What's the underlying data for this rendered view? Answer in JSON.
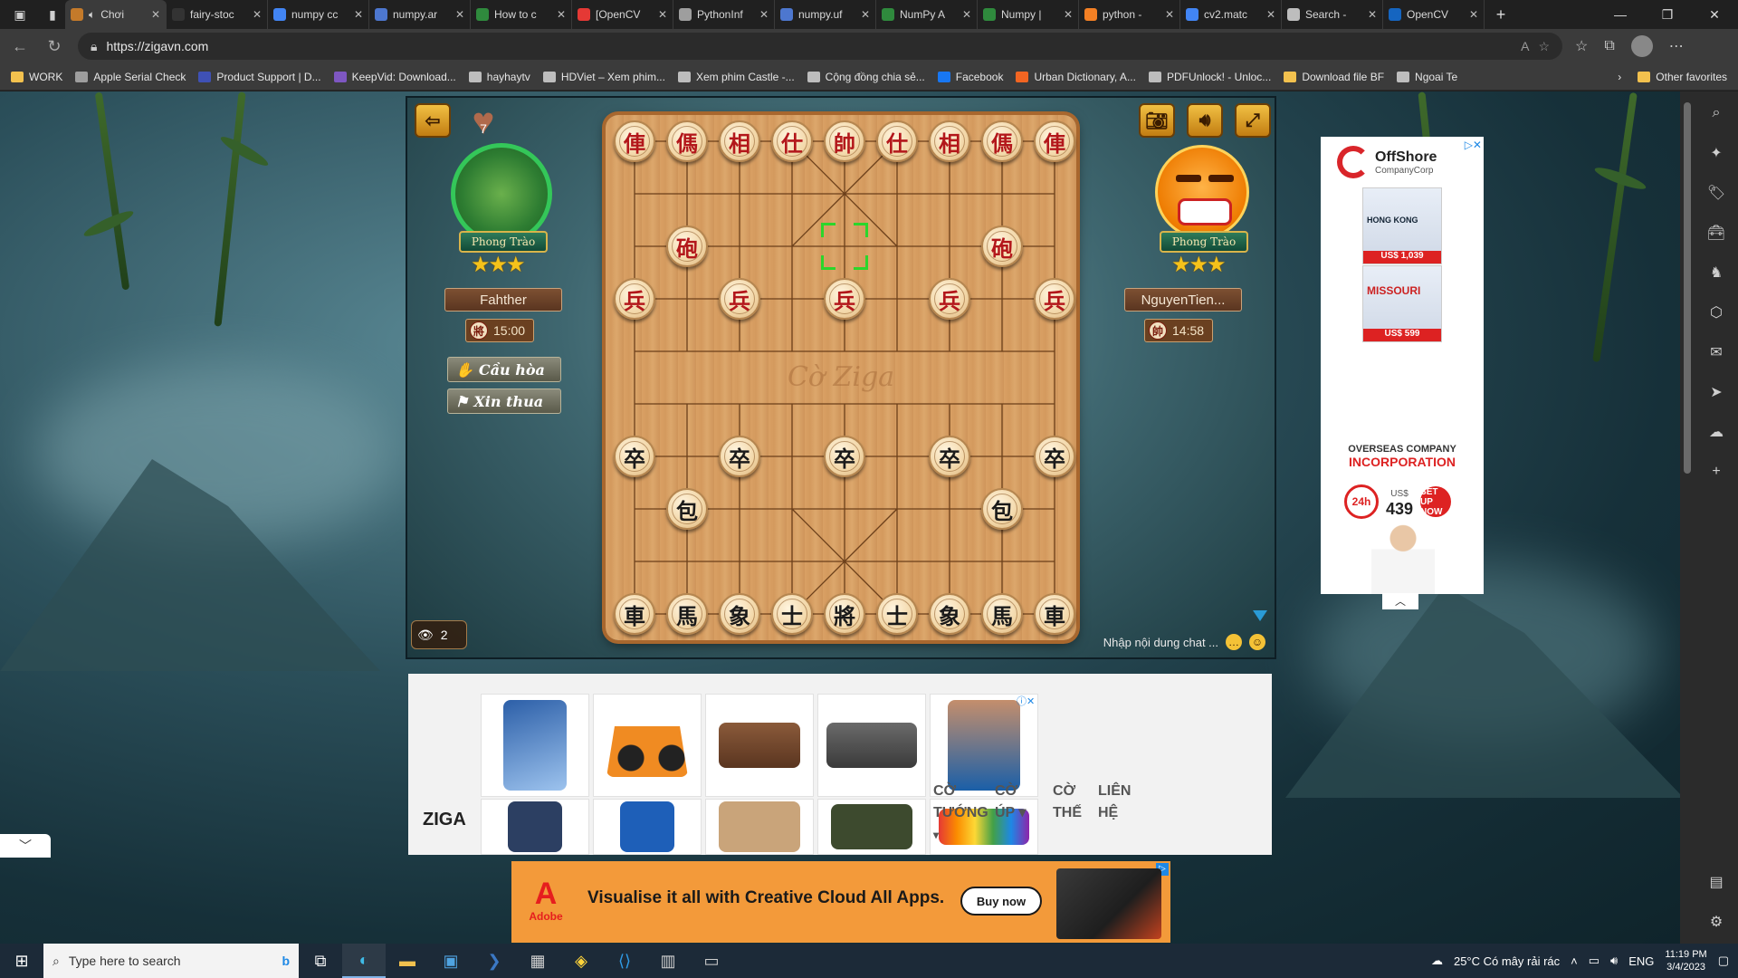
{
  "browser": {
    "tabs": [
      {
        "title": "Chơi",
        "color": "#c47a2a",
        "active": true
      },
      {
        "title": "fairy-stoc",
        "color": "#333333"
      },
      {
        "title": "numpy cc",
        "color": "#4285f4"
      },
      {
        "title": "numpy.ar",
        "color": "#4d77cf"
      },
      {
        "title": "How to c",
        "color": "#2f8a3d"
      },
      {
        "title": "[OpenCV",
        "color": "#e53935"
      },
      {
        "title": "PythonInf",
        "color": "#9e9e9e"
      },
      {
        "title": "numpy.uf",
        "color": "#4d77cf"
      },
      {
        "title": "NumPy A",
        "color": "#2f8a3d"
      },
      {
        "title": "Numpy |",
        "color": "#2f8a3d"
      },
      {
        "title": "python -",
        "color": "#f48024"
      },
      {
        "title": "cv2.matc",
        "color": "#4285f4"
      },
      {
        "title": "Search -",
        "color": "#bdbdbd"
      },
      {
        "title": "OpenCV",
        "color": "#1565c0"
      }
    ],
    "url": "https://zigavn.com",
    "bookmarks": [
      {
        "label": "WORK",
        "color": "#f2c14e"
      },
      {
        "label": "Apple Serial Check",
        "color": "#9e9e9e"
      },
      {
        "label": "Product Support | D...",
        "color": "#3f51b5"
      },
      {
        "label": "KeepVid: Download...",
        "color": "#7e57c2"
      },
      {
        "label": "hayhaytv",
        "color": "#bdbdbd"
      },
      {
        "label": "HDViet – Xem phim...",
        "color": "#bdbdbd"
      },
      {
        "label": "Xem phim Castle -...",
        "color": "#bdbdbd"
      },
      {
        "label": "Cộng đồng chia sẻ...",
        "color": "#bdbdbd"
      },
      {
        "label": "Facebook",
        "color": "#1877f2"
      },
      {
        "label": "Urban Dictionary, A...",
        "color": "#f26522"
      },
      {
        "label": "PDFUnlock! - Unloc...",
        "color": "#bdbdbd"
      },
      {
        "label": "Download file BF",
        "color": "#f2c14e"
      },
      {
        "label": "Ngoai Te",
        "color": "#bdbdbd"
      }
    ],
    "other_favorites": "Other favorites"
  },
  "game": {
    "heart_count": "7",
    "viewers": "2",
    "chat_placeholder": "Nhập nội dung chat ...",
    "river_text": "Cờ Ziga",
    "left_player": {
      "name": "Fahther",
      "rank": "Phong Trào",
      "time": "15:00",
      "timer_glyph": "將",
      "stars": "★★★"
    },
    "right_player": {
      "name": "NguyenTien...",
      "rank": "Phong Trào",
      "time": "14:58",
      "timer_glyph": "帥",
      "stars": "★★★"
    },
    "actions": {
      "draw": "Cầu hòa",
      "resign": "Xin thua"
    }
  },
  "board_pieces": [
    {
      "ch": "俥",
      "side": "red",
      "col": 0,
      "row": 0
    },
    {
      "ch": "傌",
      "side": "red",
      "col": 1,
      "row": 0
    },
    {
      "ch": "相",
      "side": "red",
      "col": 2,
      "row": 0
    },
    {
      "ch": "仕",
      "side": "red",
      "col": 3,
      "row": 0
    },
    {
      "ch": "帥",
      "side": "red",
      "col": 4,
      "row": 0
    },
    {
      "ch": "仕",
      "side": "red",
      "col": 5,
      "row": 0
    },
    {
      "ch": "相",
      "side": "red",
      "col": 6,
      "row": 0
    },
    {
      "ch": "傌",
      "side": "red",
      "col": 7,
      "row": 0
    },
    {
      "ch": "俥",
      "side": "red",
      "col": 8,
      "row": 0
    },
    {
      "ch": "砲",
      "side": "red",
      "col": 1,
      "row": 2
    },
    {
      "ch": "砲",
      "side": "red",
      "col": 7,
      "row": 2
    },
    {
      "ch": "兵",
      "side": "red",
      "col": 0,
      "row": 3
    },
    {
      "ch": "兵",
      "side": "red",
      "col": 2,
      "row": 3
    },
    {
      "ch": "兵",
      "side": "red",
      "col": 4,
      "row": 3
    },
    {
      "ch": "兵",
      "side": "red",
      "col": 6,
      "row": 3
    },
    {
      "ch": "兵",
      "side": "red",
      "col": 8,
      "row": 3
    },
    {
      "ch": "卒",
      "side": "black",
      "col": 0,
      "row": 6
    },
    {
      "ch": "卒",
      "side": "black",
      "col": 2,
      "row": 6
    },
    {
      "ch": "卒",
      "side": "black",
      "col": 4,
      "row": 6
    },
    {
      "ch": "卒",
      "side": "black",
      "col": 6,
      "row": 6
    },
    {
      "ch": "卒",
      "side": "black",
      "col": 8,
      "row": 6
    },
    {
      "ch": "包",
      "side": "black",
      "col": 1,
      "row": 7
    },
    {
      "ch": "包",
      "side": "black",
      "col": 7,
      "row": 7
    },
    {
      "ch": "車",
      "side": "black",
      "col": 0,
      "row": 9
    },
    {
      "ch": "馬",
      "side": "black",
      "col": 1,
      "row": 9
    },
    {
      "ch": "象",
      "side": "black",
      "col": 2,
      "row": 9
    },
    {
      "ch": "士",
      "side": "black",
      "col": 3,
      "row": 9
    },
    {
      "ch": "將",
      "side": "black",
      "col": 4,
      "row": 9
    },
    {
      "ch": "士",
      "side": "black",
      "col": 5,
      "row": 9
    },
    {
      "ch": "象",
      "side": "black",
      "col": 6,
      "row": 9
    },
    {
      "ch": "馬",
      "side": "black",
      "col": 7,
      "row": 9
    },
    {
      "ch": "車",
      "side": "black",
      "col": 8,
      "row": 9
    }
  ],
  "board_highlight": {
    "col": 4,
    "row": 2
  },
  "side_ad": {
    "brand": "OffShore",
    "brand_sub": "CompanyCorp",
    "img1_title": "HONG KONG",
    "img1_price": "US$ 1,039",
    "img2_title": "MISSOURI",
    "img2_price": "US$ 599",
    "headline_a": "OVERSEAS COMPANY",
    "headline_b": "INCORPORATION",
    "badge": "24h",
    "price_cur": "US$",
    "price": "439",
    "cta": "SET UP NOW"
  },
  "site": {
    "logo": "ZIGA",
    "menu": [
      {
        "line1": "CỜ",
        "line2": "TƯỚNG",
        "dropdown": "▾"
      },
      {
        "line1": "CỜ",
        "line2": "ÚP ▾",
        "dropdown": ""
      },
      {
        "line1": "CỜ",
        "line2": "THẾ",
        "dropdown": ""
      },
      {
        "line1": "LIÊN",
        "line2": "HỆ",
        "dropdown": ""
      }
    ]
  },
  "banner_ad": {
    "brand": "Adobe",
    "message": "Visualise it all with Creative Cloud All Apps.",
    "cta": "Buy now"
  },
  "taskbar": {
    "search_placeholder": "Type here to search",
    "weather": "25°C  Có mây rải rác",
    "lang": "ENG",
    "time": "11:19 PM",
    "date": "3/4/2023"
  }
}
